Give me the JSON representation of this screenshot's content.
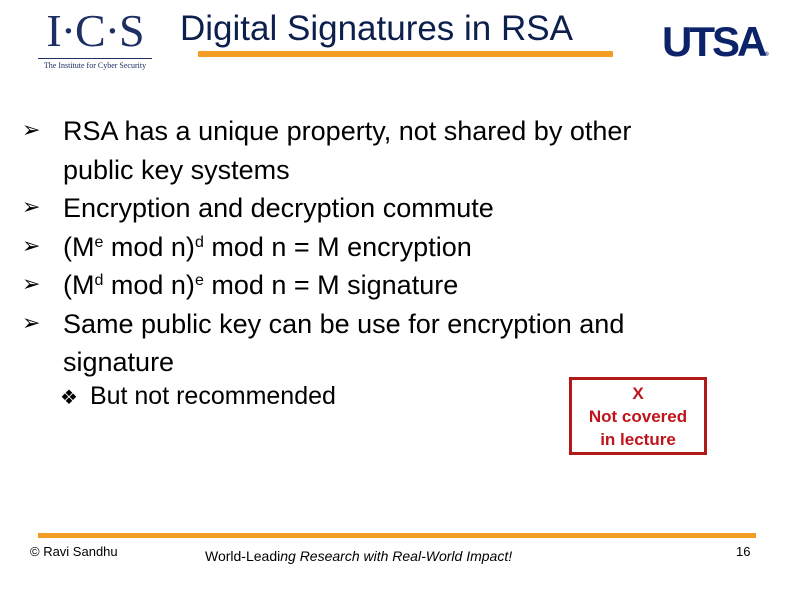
{
  "header": {
    "ics_logo": {
      "mark": "I·C·S",
      "subtitle": "The Institute for Cyber Security"
    },
    "title": "Digital Signatures in RSA",
    "utsa_logo": {
      "text": "UTSA",
      "reg": "®"
    }
  },
  "colors": {
    "accent_orange": "#f39c26",
    "title_navy": "#0d1f4d",
    "utsa_navy": "#0c2369",
    "warning_red": "#c0141c"
  },
  "bullets": [
    {
      "icon": "arrow-bullet",
      "lines": [
        "RSA has a unique property, not shared by other",
        "public key systems"
      ]
    },
    {
      "icon": "arrow-bullet",
      "lines": [
        "Encryption and decryption commute"
      ]
    },
    {
      "icon": "arrow-bullet",
      "parts": {
        "open": "(M",
        "sup1": "e",
        "mid": " mod n)",
        "sup2": "d",
        "rest": " mod n = M  encryption"
      }
    },
    {
      "icon": "arrow-bullet",
      "parts": {
        "open": "(M",
        "sup1": "d",
        "mid": " mod n)",
        "sup2": "e",
        "rest": " mod n = M  signature"
      }
    },
    {
      "icon": "arrow-bullet",
      "lines": [
        "Same public key can be use for encryption and",
        "signature"
      ]
    }
  ],
  "sub_bullet": {
    "icon": "diamond-bullet",
    "text": "But not recommended"
  },
  "not_covered_box": {
    "line1": "X",
    "line2": "Not covered",
    "line3": "in lecture"
  },
  "footer": {
    "copyright": "© Ravi  Sandhu",
    "tagline_a": "World-Leadi",
    "tagline_b": "ng Research with Real-World Impact!",
    "page_number": "16"
  }
}
